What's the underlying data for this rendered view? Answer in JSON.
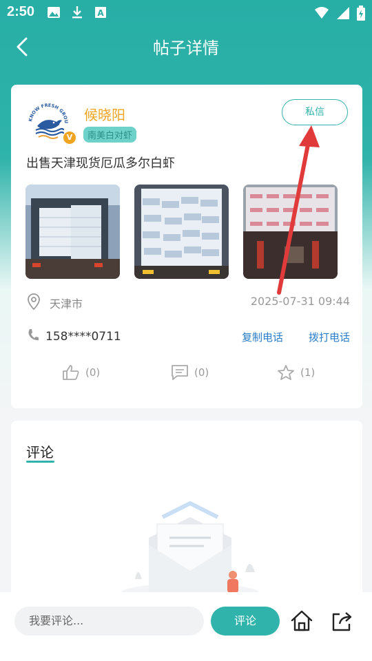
{
  "status_bar": {
    "time": "2:50",
    "left_icons": [
      "image-icon",
      "download-icon",
      "text-a-icon"
    ],
    "right_icons": [
      "wifi-icon",
      "signal-icon",
      "battery-icon"
    ]
  },
  "header": {
    "title": "帖子详情",
    "back_icon": "chevron-left-icon"
  },
  "post": {
    "author": {
      "name": "候晓阳",
      "tag": "南美白对虾",
      "verified_badge": "V",
      "avatar_text": "KNOW FRESH GROUP"
    },
    "private_message_label": "私信",
    "title": "出售天津现货厄瓜多尔白虾",
    "photos": [
      "photo-1",
      "photo-2",
      "photo-3"
    ],
    "location": "天津市",
    "date": "2025-07-31 09:44",
    "phone": "158****0711",
    "copy_phone_label": "复制电话",
    "call_phone_label": "拨打电话",
    "likes": "(0)",
    "comments": "(0)",
    "favorites": "(1)"
  },
  "comments_section": {
    "title": "评论"
  },
  "bottom_bar": {
    "input_placeholder": "我要评论...",
    "submit_label": "评论"
  },
  "colors": {
    "brand": "#2fb3aa",
    "author_name": "#f0a522",
    "link": "#2a7dc9",
    "annotation_arrow": "#e03a3a"
  }
}
